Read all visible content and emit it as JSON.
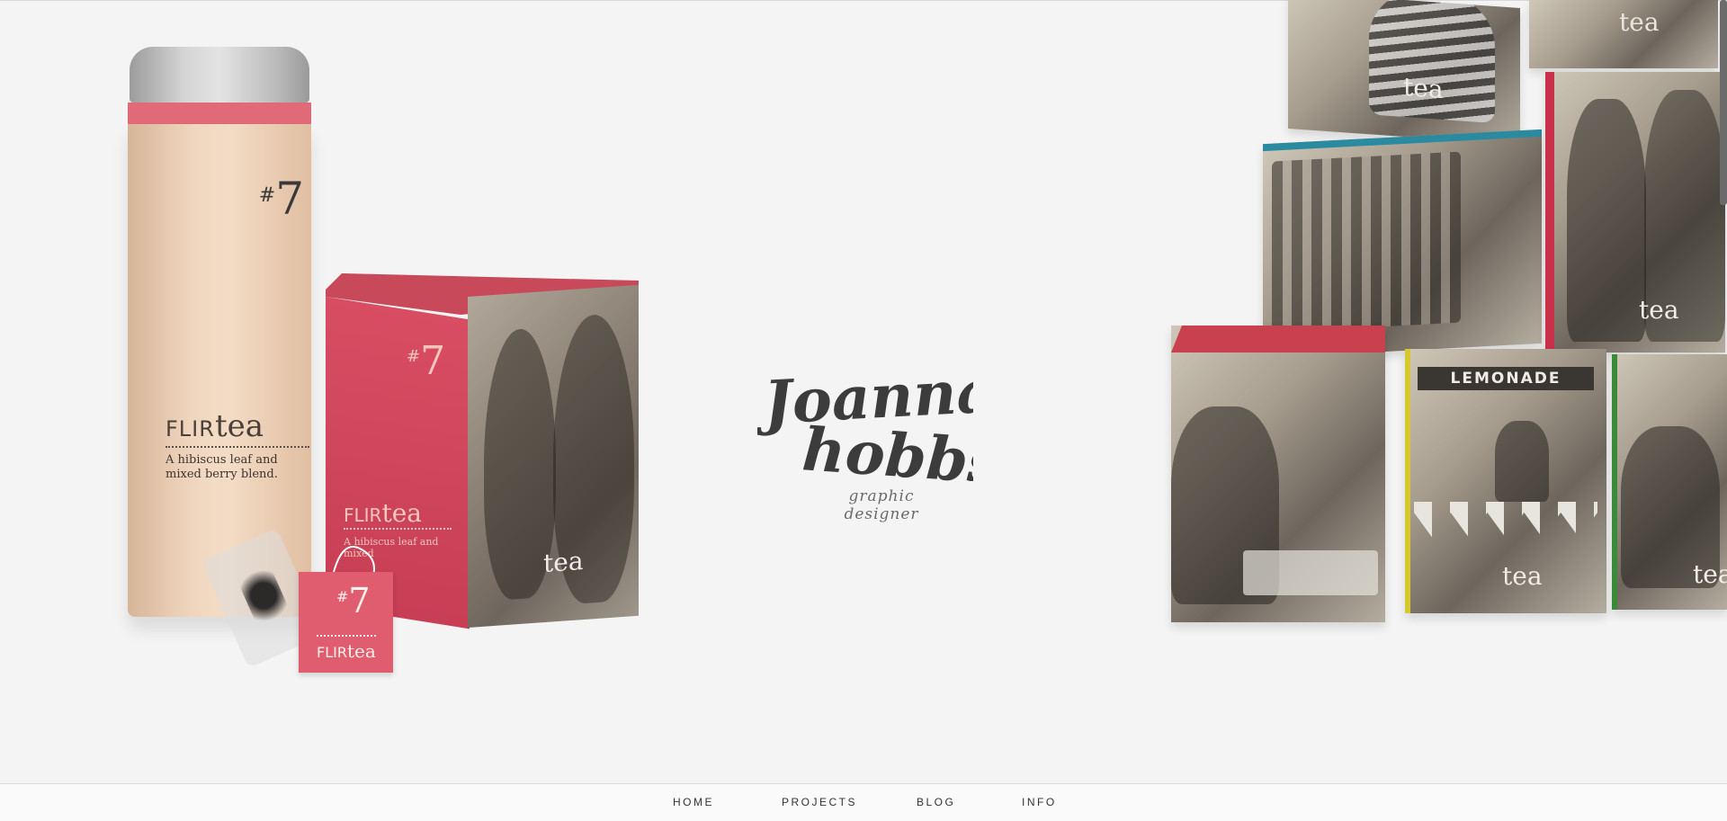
{
  "brand": {
    "logo_line1": "Joanna",
    "logo_line2": "hobbs",
    "tagline": "graphic designer"
  },
  "products": {
    "canister": {
      "hash": "#",
      "number": "7",
      "brand_prefix": "FLIR",
      "brand_suffix": "tea",
      "description": "A hibiscus leaf and mixed berry blend."
    },
    "box": {
      "hash": "#",
      "number": "7",
      "brand_prefix": "FLIR",
      "brand_suffix": "tea",
      "description": "A hibiscus leaf and mixed",
      "side_label": "tea"
    },
    "tag": {
      "hash": "#",
      "number": "7",
      "brand_prefix": "FLIR",
      "brand_suffix": "tea"
    }
  },
  "stack_boxes": [
    {
      "label": "tea"
    },
    {
      "label": "tea"
    },
    {
      "label": "tea"
    },
    {
      "label": "LEMONADE"
    },
    {
      "label": "tea"
    },
    {
      "label": "tea"
    }
  ],
  "nav": {
    "items": [
      {
        "label": "HOME"
      },
      {
        "label": "PROJECTS"
      },
      {
        "label": "BLOG"
      },
      {
        "label": "INFO"
      }
    ]
  },
  "colors": {
    "accent_pink": "#e06a78",
    "background": "#f4f4f4",
    "logo_gray": "#3c3c3c"
  }
}
